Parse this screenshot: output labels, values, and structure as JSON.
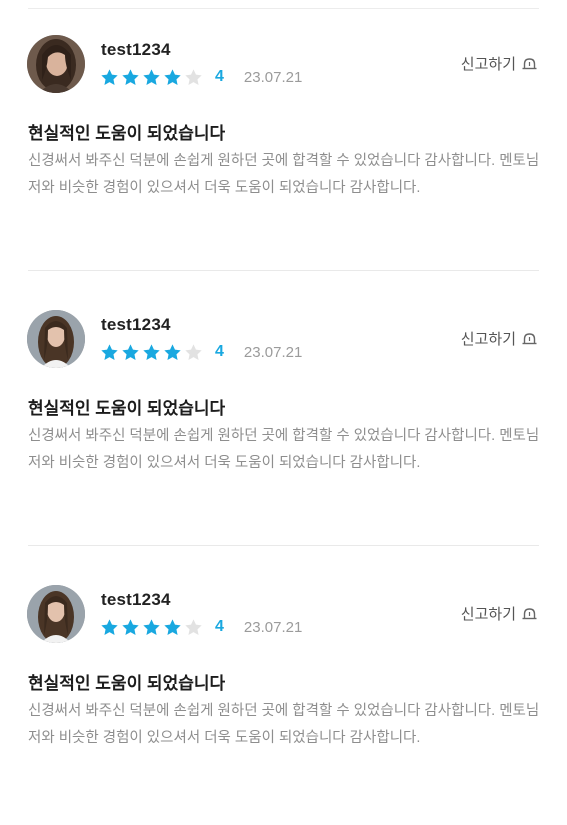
{
  "reviews": [
    {
      "username": "test1234",
      "rating": 4,
      "rating_max": 5,
      "rating_text": "4",
      "date": "23.07.21",
      "report_label": "신고하기",
      "report_icon": "siren-icon",
      "title": "현실적인 도움이 되었습니다",
      "body": "신경써서 봐주신 덕분에 손쉽게 원하던 곳에 합격할 수 있었습니다 감사합니다. 멘토님 저와 비슷한 경험이 있으셔서 더욱 도움이 되었습니다 감사합니다."
    },
    {
      "username": "test1234",
      "rating": 4,
      "rating_max": 5,
      "rating_text": "4",
      "date": "23.07.21",
      "report_label": "신고하기",
      "report_icon": "siren-icon",
      "title": "현실적인 도움이 되었습니다",
      "body": "신경써서 봐주신 덕분에 손쉽게 원하던 곳에 합격할 수 있었습니다 감사합니다. 멘토님 저와 비슷한 경험이 있으셔서 더욱 도움이 되었습니다 감사합니다."
    },
    {
      "username": "test1234",
      "rating": 4,
      "rating_max": 5,
      "rating_text": "4",
      "date": "23.07.21",
      "report_label": "신고하기",
      "report_icon": "siren-icon",
      "title": "현실적인 도움이 되었습니다",
      "body": "신경써서 봐주신 덕분에 손쉽게 원하던 곳에 합격할 수 있었습니다 감사합니다. 멘토님 저와 비슷한 경험이 있으셔서 더욱 도움이 되었습니다 감사합니다."
    }
  ],
  "colors": {
    "star_filled": "#19a8e0",
    "star_empty": "#e2e2e2",
    "rating_text": "#19a8e0",
    "date_text": "#9b9b9b",
    "body_text": "#8e8e8e",
    "divider": "#e9e9e9"
  }
}
